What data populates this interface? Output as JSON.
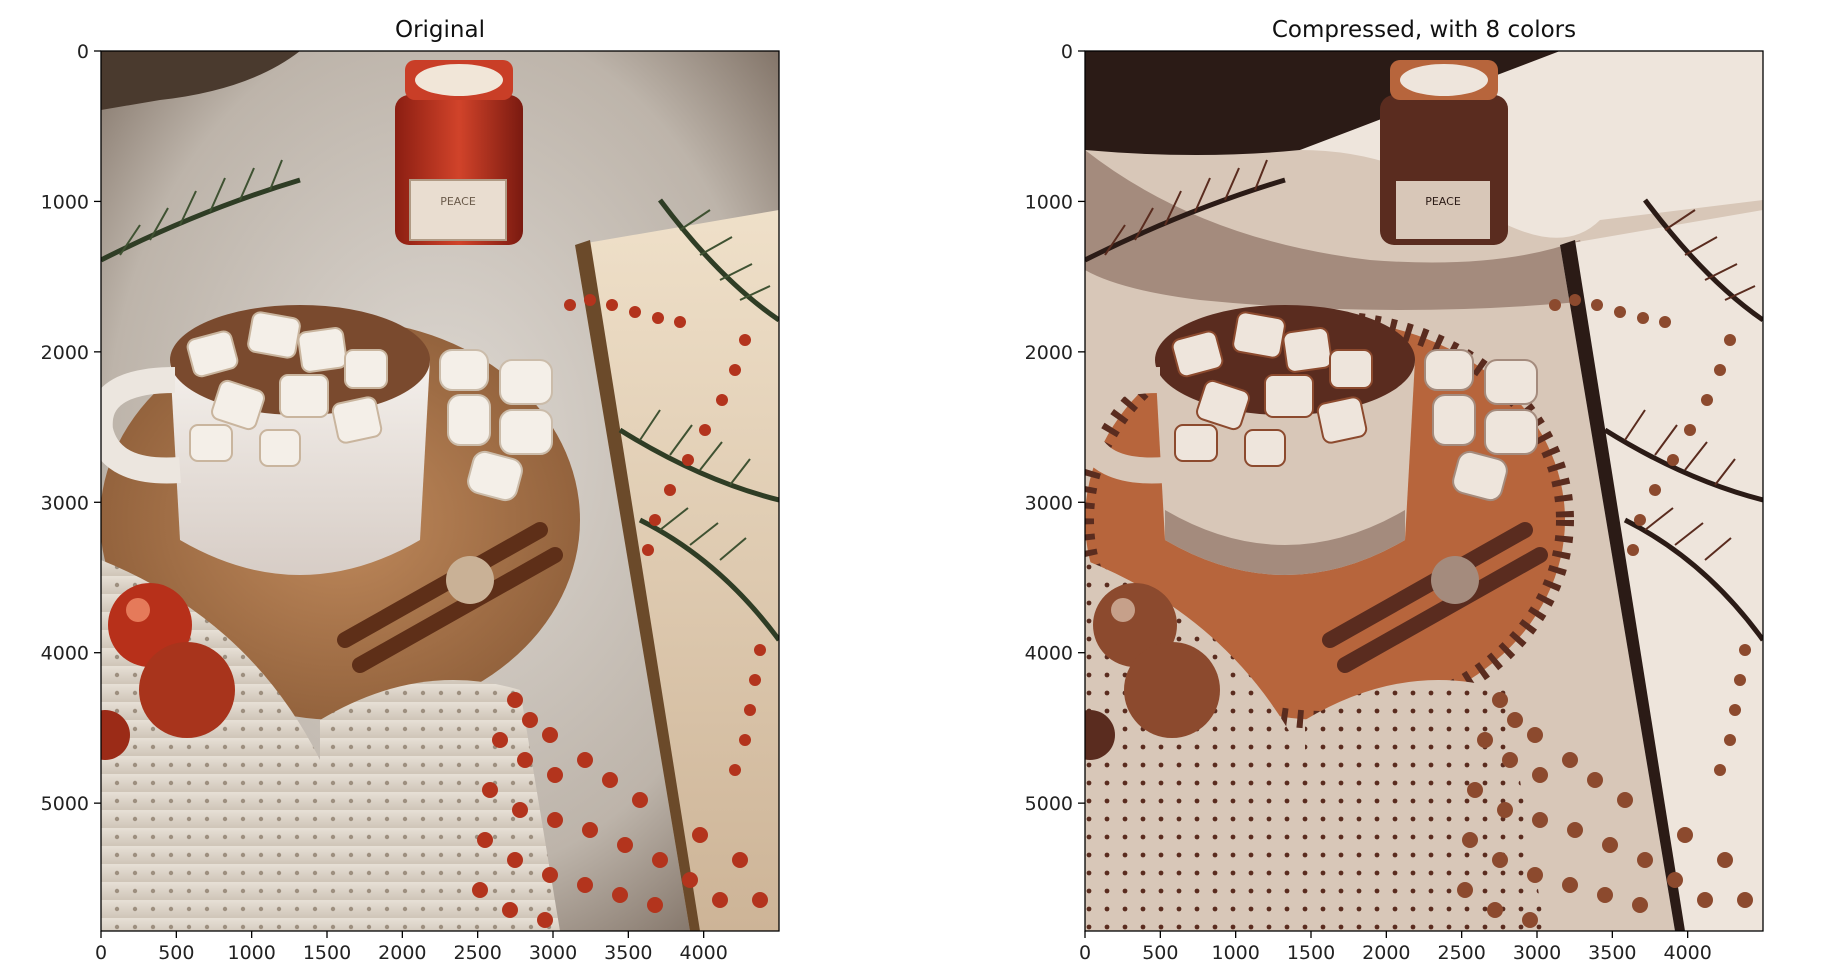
{
  "chart_data": [
    {
      "type": "image",
      "title": "Original",
      "xlim": [
        0,
        4500
      ],
      "ylim": [
        5850,
        0
      ],
      "xticks": [
        0,
        500,
        1000,
        1500,
        2000,
        2500,
        3000,
        3500,
        4000
      ],
      "yticks": [
        0,
        1000,
        2000,
        3000,
        4000,
        5000
      ],
      "xtick_labels": [
        "0",
        "500",
        "1000",
        "1500",
        "2000",
        "2500",
        "3000",
        "3500",
        "4000"
      ],
      "ytick_labels": [
        "0",
        "1000",
        "2000",
        "3000",
        "4000",
        "5000"
      ],
      "palette": [
        "#2a1d19",
        "#7a2a1b",
        "#b24a2a",
        "#8d5a3a",
        "#c79a72",
        "#e8dccd",
        "#f2efe9",
        "#3e4b2f"
      ],
      "image_description_colors": {
        "background": "#d9d4cf",
        "mug": "#ece7e2",
        "cork": "#b07d52",
        "jar": "#b8321d"
      }
    },
    {
      "type": "image",
      "title": "Compressed, with 8 colors",
      "xlim": [
        0,
        4500
      ],
      "ylim": [
        5850,
        0
      ],
      "xticks": [
        0,
        500,
        1000,
        1500,
        2000,
        2500,
        3000,
        3500,
        4000
      ],
      "yticks": [
        0,
        1000,
        2000,
        3000,
        4000,
        5000
      ],
      "xtick_labels": [
        "0",
        "500",
        "1000",
        "1500",
        "2000",
        "2500",
        "3000",
        "3500",
        "4000"
      ],
      "ytick_labels": [
        "0",
        "1000",
        "2000",
        "3000",
        "4000",
        "5000"
      ],
      "palette": [
        "#2b1b16",
        "#5a2c1f",
        "#8c4a2e",
        "#b7653c",
        "#a48b7d",
        "#d8c7b8",
        "#eee5dc",
        "#c6a08a"
      ],
      "image_description_colors": {
        "background": "#d8c7b8",
        "mug": "#e2d6cc",
        "cork": "#b7653c",
        "jar": "#8c4a2e"
      }
    }
  ]
}
